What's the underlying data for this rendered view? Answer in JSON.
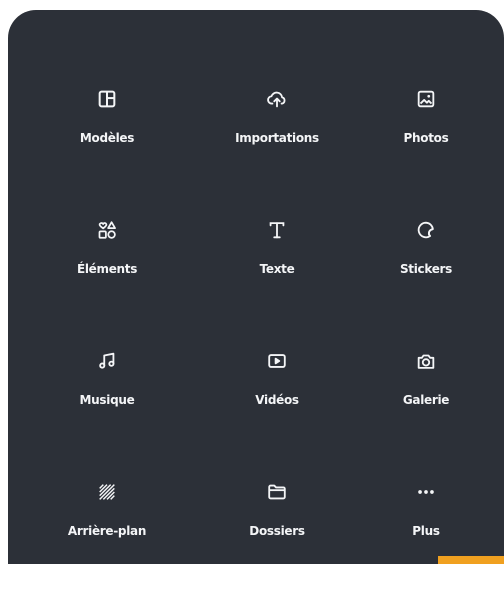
{
  "menu": {
    "items": [
      {
        "id": "modeles",
        "label": "Modèles",
        "icon": "layout-icon"
      },
      {
        "id": "importations",
        "label": "Importations",
        "icon": "cloud-upload-icon"
      },
      {
        "id": "photos",
        "label": "Photos",
        "icon": "image-icon"
      },
      {
        "id": "elements",
        "label": "Éléments",
        "icon": "shapes-icon"
      },
      {
        "id": "texte",
        "label": "Texte",
        "icon": "text-icon"
      },
      {
        "id": "stickers",
        "label": "Stickers",
        "icon": "sticker-icon"
      },
      {
        "id": "musique",
        "label": "Musique",
        "icon": "music-icon"
      },
      {
        "id": "videos",
        "label": "Vidéos",
        "icon": "video-icon"
      },
      {
        "id": "galerie",
        "label": "Galerie",
        "icon": "camera-icon"
      },
      {
        "id": "arriere-plan",
        "label": "Arrière-plan",
        "icon": "background-pattern-icon"
      },
      {
        "id": "dossiers",
        "label": "Dossiers",
        "icon": "folder-icon"
      },
      {
        "id": "plus",
        "label": "Plus",
        "icon": "more-dots-icon"
      }
    ]
  },
  "colors": {
    "panel_bg": "#2c3038",
    "text": "#f4f5f7",
    "accent_strip": "#f0a020"
  }
}
